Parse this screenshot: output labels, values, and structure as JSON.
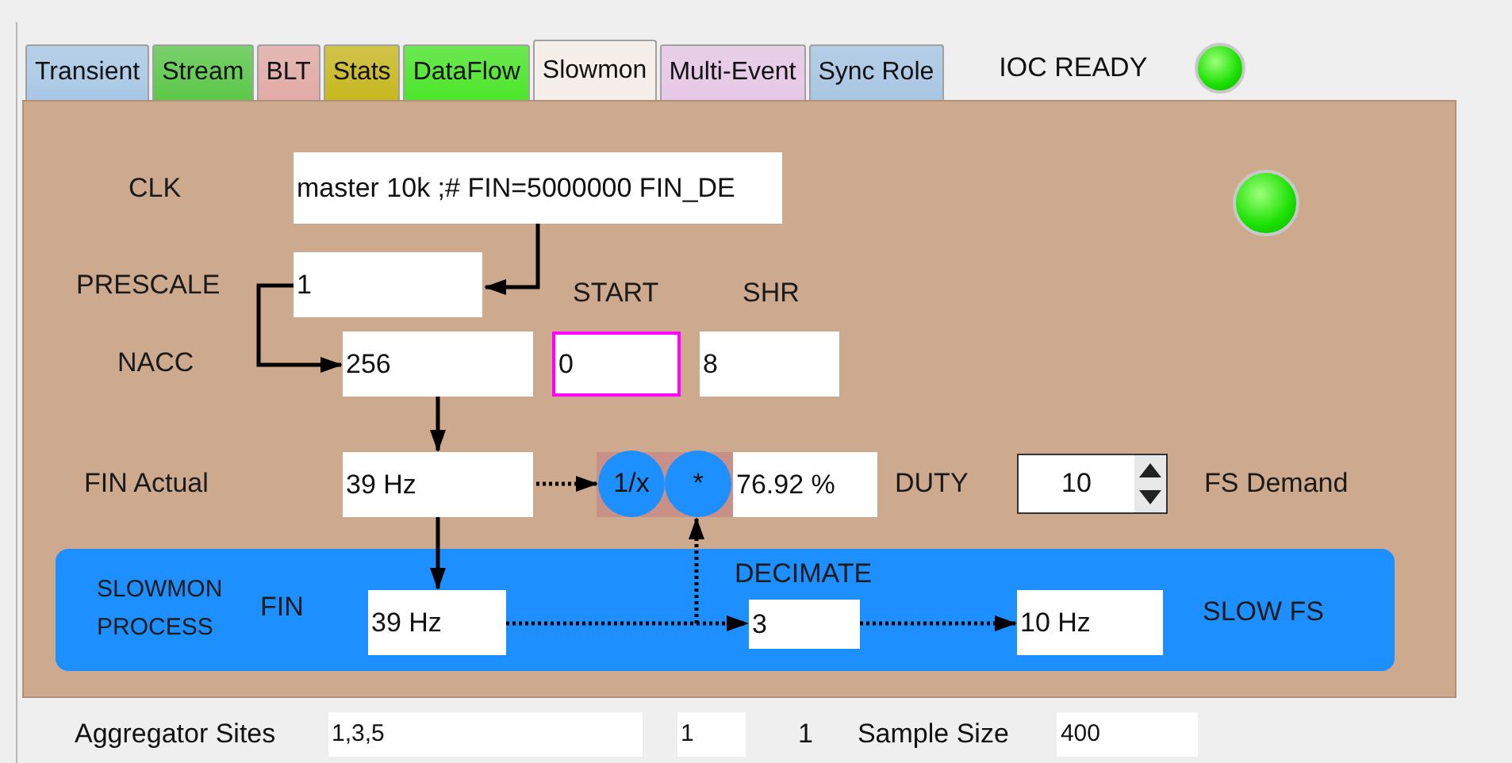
{
  "tabs": [
    {
      "label": "Transient",
      "color": "#a9c8e6",
      "selected": false
    },
    {
      "label": "Stream",
      "color": "#5cc84a",
      "selected": false
    },
    {
      "label": "BLT",
      "color": "#e2aaa6",
      "selected": false
    },
    {
      "label": "Stats",
      "color": "#c8b820",
      "selected": false
    },
    {
      "label": "DataFlow",
      "color": "#4ce62a",
      "selected": false
    },
    {
      "label": "Slowmon",
      "color": "#f6eee8",
      "selected": true
    },
    {
      "label": "Multi-Event",
      "color": "#e6c8e6",
      "selected": false
    },
    {
      "label": "Sync Role",
      "color": "#a8c6e4",
      "selected": false
    }
  ],
  "status": {
    "label": "IOC READY",
    "led_on": true
  },
  "panel_led": {
    "on": true
  },
  "clk": {
    "label": "CLK",
    "value": "master 10k ;# FIN=5000000 FIN_DE"
  },
  "prescale": {
    "label": "PRESCALE",
    "value": "1"
  },
  "nacc": {
    "label": "NACC",
    "value": "256"
  },
  "start": {
    "label": "START",
    "value": "0",
    "focused": true
  },
  "shr": {
    "label": "SHR",
    "value": "8"
  },
  "fin_actual": {
    "label": "FIN Actual",
    "value": "39 Hz"
  },
  "operators": [
    "1/x",
    "*"
  ],
  "duty": {
    "value": "76.92 %",
    "label": "DUTY"
  },
  "fs_demand": {
    "value": "10",
    "label": "FS Demand"
  },
  "slowmon_process": {
    "title": "SLOWMON PROCESS",
    "fin_label": "FIN",
    "fin_value": "39 Hz",
    "decimate_label": "DECIMATE",
    "decimate_value": "3",
    "slow_fs_value": "10 Hz",
    "slow_fs_label": "SLOW FS"
  },
  "bottom": {
    "aggregator_label": "Aggregator Sites",
    "aggregator_value": "1,3,5",
    "field_2": "1",
    "text_2": "1",
    "sample_size_label": "Sample Size",
    "sample_size_value": "400"
  }
}
